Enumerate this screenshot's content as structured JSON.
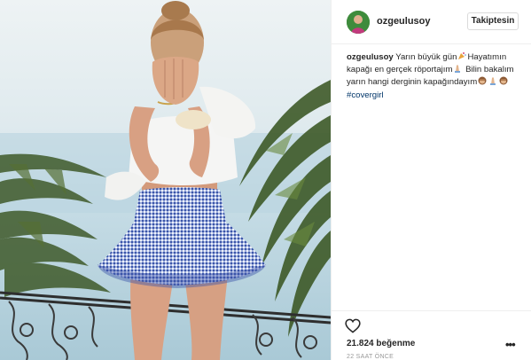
{
  "post": {
    "username": "ozgeulusoy",
    "follow_label": "Takiptesin",
    "caption": {
      "username": "ozgeulusoy",
      "line1": "Yarın büyük gün",
      "line2": "Hayatımın kapağı en gerçek röportajım",
      "line3": "Bilin bakalım yarın hangi derginin kapağındayım",
      "hashtag": "#covergirl"
    },
    "likes": "21.824 beğenme",
    "timestamp": "22 SAAT ÖNCE",
    "more_label": "•••"
  },
  "icons": {
    "like": "heart-icon",
    "more": "more-options-icon"
  },
  "colors": {
    "hashtag": "#003569",
    "text": "#262626",
    "muted": "#999999",
    "border": "#efefef"
  }
}
